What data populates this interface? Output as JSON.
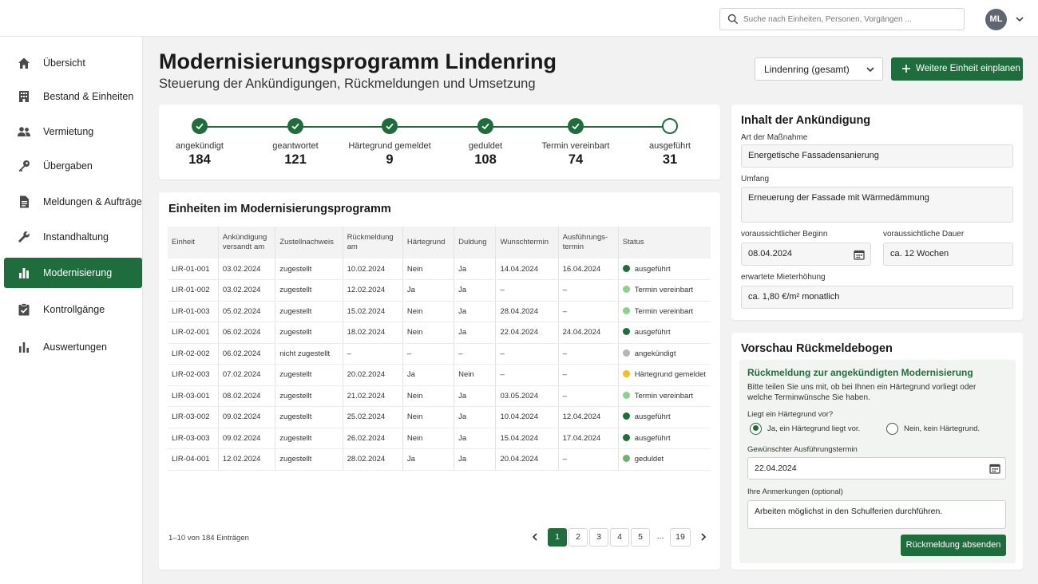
{
  "search": {
    "placeholder": "Suche nach Einheiten, Personen, Vorgängen ..."
  },
  "user": {
    "initials": "ML"
  },
  "sidebar": {
    "items": [
      {
        "label": "Übersicht",
        "icon": "home-icon"
      },
      {
        "label": "Bestand & Einheiten",
        "icon": "building-icon"
      },
      {
        "label": "Vermietung",
        "icon": "people-icon"
      },
      {
        "label": "Übergaben",
        "icon": "key-icon"
      },
      {
        "label": "Meldungen & Aufträge",
        "icon": "document-icon"
      },
      {
        "label": "Instandhaltung",
        "icon": "wrench-icon"
      },
      {
        "label": "Modernisierung",
        "icon": "bar-chart-icon",
        "active": true
      },
      {
        "label": "Kontrollgänge",
        "icon": "checklist-icon"
      },
      {
        "label": "Auswertungen",
        "icon": "analytics-icon"
      }
    ]
  },
  "header": {
    "title": "Modernisierungsprogramm Lindenring",
    "subtitle": "Steuerung der Ankündigungen, Rückmeldungen und Umsetzung",
    "filter_value": "Lindenring (gesamt)",
    "primary_button": "Weitere Einheit einplanen"
  },
  "steps": [
    {
      "label": "angekündigt",
      "count": "184",
      "done": true
    },
    {
      "label": "geantwortet",
      "count": "121",
      "done": true
    },
    {
      "label": "Härtegrund gemeldet",
      "count": "9",
      "done": true
    },
    {
      "label": "geduldet",
      "count": "108",
      "done": true
    },
    {
      "label": "Termin vereinbart",
      "count": "74",
      "done": true
    },
    {
      "label": "ausgeführt",
      "count": "31",
      "done": false
    }
  ],
  "table": {
    "title": "Einheiten im Modernisierungsprogramm",
    "columns": [
      "Einheit",
      "Ankündigung versandt am",
      "Zustellnachweis",
      "Rückmeldung am",
      "Härtegrund",
      "Duldung",
      "Wunschtermin",
      "Ausführungs-termin",
      "Status"
    ],
    "rows": [
      [
        "LIR-01-001",
        "03.02.2024",
        "zugestellt",
        "10.02.2024",
        "Nein",
        "Ja",
        "14.04.2024",
        "16.04.2024",
        "ausgeführt"
      ],
      [
        "LIR-01-002",
        "03.02.2024",
        "zugestellt",
        "12.02.2024",
        "Ja",
        "Ja",
        "–",
        "–",
        "Termin vereinbart"
      ],
      [
        "LIR-01-003",
        "05.02.2024",
        "zugestellt",
        "15.02.2024",
        "Nein",
        "Ja",
        "28.04.2024",
        "–",
        "Termin vereinbart"
      ],
      [
        "LIR-02-001",
        "06.02.2024",
        "zugestellt",
        "18.02.2024",
        "Nein",
        "Ja",
        "22.04.2024",
        "24.04.2024",
        "ausgeführt"
      ],
      [
        "LIR-02-002",
        "06.02.2024",
        "nicht zugestellt",
        "–",
        "–",
        "–",
        "–",
        "–",
        "angekündigt"
      ],
      [
        "LIR-02-003",
        "07.02.2024",
        "zugestellt",
        "20.02.2024",
        "Ja",
        "Nein",
        "–",
        "–",
        "Härtegrund gemeldet"
      ],
      [
        "LIR-03-001",
        "08.02.2024",
        "zugestellt",
        "21.02.2024",
        "Nein",
        "Ja",
        "03.05.2024",
        "–",
        "Termin vereinbart"
      ],
      [
        "LIR-03-002",
        "09.02.2024",
        "zugestellt",
        "25.02.2024",
        "Nein",
        "Ja",
        "10.04.2024",
        "12.04.2024",
        "ausgeführt"
      ],
      [
        "LIR-03-003",
        "09.02.2024",
        "zugestellt",
        "26.02.2024",
        "Nein",
        "Ja",
        "15.04.2024",
        "17.04.2024",
        "ausgeführt"
      ],
      [
        "LIR-04-001",
        "12.02.2024",
        "zugestellt",
        "28.02.2024",
        "Ja",
        "Ja",
        "20.04.2024",
        "–",
        "geduldet"
      ]
    ],
    "status_colors": {
      "ausgeführt": "#1f6d3c",
      "Termin vereinbart": "#8fcf8f",
      "angekündigt": "#b5b5b5",
      "Härtegrund gemeldet": "#f0c020",
      "geduldet": "#6db36d"
    },
    "count_text": "1–10 von 184 Einträgen",
    "pages": [
      "1",
      "2",
      "3",
      "4",
      "5",
      "...",
      "19"
    ],
    "current_page": "1"
  },
  "content": {
    "title": "Inhalt der Ankündigung",
    "measure_label": "Art der Maßnahme",
    "measure_value": "Energetische Fassadensanierung",
    "scope_label": "Umfang",
    "scope_value": "Erneuerung der Fassade mit Wärmedämmung",
    "start_label": "voraussichtlicher Beginn",
    "start_value": "08.04.2024",
    "duration_label": "voraussichtliche Dauer",
    "duration_value": "ca. 12 Wochen",
    "rent_label": "erwartete Mieterhöhung",
    "rent_value": "ca. 1,80 €/m² monatlich"
  },
  "preview": {
    "title": "Vorschau Rückmeldebogen",
    "form_title": "Rückmeldung zur angekündigten Modernisierung",
    "form_text": "Bitte teilen Sie uns mit, ob bei Ihnen ein Härtegrund vorliegt oder welche Terminwünsche Sie haben.",
    "question": "Liegt ein Härtegrund vor?",
    "option_yes": "Ja, ein Härtegrund liegt vor.",
    "option_no": "Nein, kein Härtegrund.",
    "date_label": "Gewünschter Ausführungstermin",
    "date_value": "22.04.2024",
    "notes_label": "Ihre Anmerkungen (optional)",
    "notes_value": "Arbeiten möglichst in den Schulferien durchführen.",
    "submit": "Rückmeldung absenden"
  }
}
